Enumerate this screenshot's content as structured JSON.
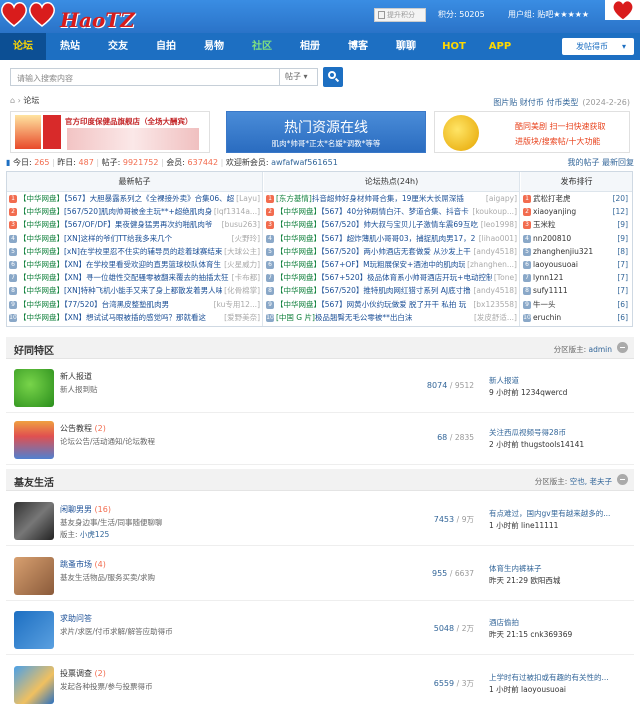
{
  "header": {
    "logo_text": "HaoTZ",
    "upgrade_label": "提升积分",
    "points": "积分: 50205",
    "user_group": "用户组: 贴吧★★★★★"
  },
  "nav": {
    "items": [
      "论坛",
      "热站",
      "交友",
      "自拍",
      "易物",
      "社区",
      "相册",
      "博客",
      "聊聊",
      "HOT",
      "APP"
    ],
    "post_select": "发帖得币"
  },
  "search": {
    "placeholder": "请输入搜索内容",
    "category": "帖子"
  },
  "breadcrumb": {
    "current": "论坛",
    "links": "图片贴 财付币 付币类型",
    "date": "(2024-2-26)"
  },
  "ads": {
    "shop": "官方印度保健品旗舰店（全场大酬宾）",
    "hot_title": "热门资源在线",
    "hot_sub": "肌肉*帅哥*正太*名媛*调教*等等",
    "right_line1": "酷同美剧 扫一扫快速获取",
    "right_line2": "进版块/搜索帖/十大功能"
  },
  "stats": {
    "today_label": "今日:",
    "today": "265",
    "yesterday_label": "昨日:",
    "yesterday": "487",
    "posts_label": "帖子:",
    "posts": "9921752",
    "members_label": "会员:",
    "members": "637442",
    "welcome_label": "欢迎新会员:",
    "newest": "awfafwaf561651",
    "my_posts": "我的帖子",
    "new_replies": "最新回复"
  },
  "hot": {
    "headers": [
      "最新帖子",
      "论坛热点(24h)",
      "发布排行"
    ],
    "latest": [
      {
        "tag": "【中华网盘】",
        "text": "【567】大胆暴露系列之《全裸接外卖》合集06、超",
        "user": "[Layu]"
      },
      {
        "tag": "【中华网盘】",
        "text": "[567/520]肌肉帅哥被金主玩**+超绝肌肉身材",
        "user": "[lqf1314a...]"
      },
      {
        "tag": "【中华网盘】",
        "text": "【567/OF/DF】果夜健身猛男再次约啪肌肉爷",
        "user": "[busu263]"
      },
      {
        "tag": "【中华网盘】",
        "text": "[XN]这样的爷们TT给我多来几个",
        "user": "[火野玲]"
      },
      {
        "tag": "【中华网盘】",
        "text": "[xN]在学校里忍不住实的辅导员的趁着球赛结束",
        "user": "[大球公主]"
      },
      {
        "tag": "【中华网盘】",
        "text": "【XN】在学校里看受欢迎的直男篮球校队体育生",
        "user": "[火星威力]"
      },
      {
        "tag": "【中华网盘】",
        "text": "【XN】寻一位雄性交配骚零被翻来覆去的抽插太狂",
        "user": "[卡布都]"
      },
      {
        "tag": "【中华网盘】",
        "text": "[XN]特种飞机小能手又来了身上都散发着男人味",
        "user": "[化骨棉掌]"
      },
      {
        "tag": "【中华网盘】",
        "text": "【77/520】台湾黑皮整塾肌肉男",
        "user": "[ku专用12...]"
      },
      {
        "tag": "【中华网盘】",
        "text": "【XN】想试试马眼被插的感觉吗？那就看这",
        "user": "[爱野美奈]"
      }
    ],
    "trending": [
      {
        "tag": "[东方基情]",
        "text": "抖音超帅好身材帅哥合集，19厘米大长屌深插",
        "user": "[aigapy]"
      },
      {
        "tag": "【中华网盘】",
        "text": "【567】40分钟刷情白汗、梦道合集、抖音卡",
        "user": "[koukoup...]"
      },
      {
        "tag": "【中华网盘】",
        "text": "【567/520】帅大叔与宝贝儿子激情车震69互吃",
        "user": "[leo1998]"
      },
      {
        "tag": "【中华网盘】",
        "text": "【567】超炸薄肌小哥哥03，捕捉肌肉男17，2",
        "user": "[lihao001]"
      },
      {
        "tag": "【中华网盘】",
        "text": "【567/520】两小帅酒店无套做爱 从沙发上干",
        "user": "[andy4518]"
      },
      {
        "tag": "【中华网盘】",
        "text": "【567+OF】M玩粗展保安+酒池中的肌肉玩",
        "user": "[zhanghen...]"
      },
      {
        "tag": "【中华网盘】",
        "text": "【567+520】极品体育系小帅哥酒店开玩+电动控制猛",
        "user": "[Tone]"
      },
      {
        "tag": "【中华网盘】",
        "text": "【567/520】推特肌肉网红猎寸系列 AJ底寸撸",
        "user": "[andy4518]"
      },
      {
        "tag": "【中华网盘】",
        "text": "【567】网黄小伙约玩做爱 脱了开干 私拍 玩",
        "user": "[bx123558]"
      },
      {
        "tag": "[中国 G 片]",
        "text": "极品翘臀无毛公零被**出白沫",
        "user": "[发皮舒适...]"
      }
    ],
    "ranking": [
      {
        "name": "武松打老虎",
        "count": "[20]"
      },
      {
        "name": "xiaoyanjing",
        "count": "[12]"
      },
      {
        "name": "玉米粒",
        "count": "[9]"
      },
      {
        "name": "nn200810",
        "count": "[9]"
      },
      {
        "name": "zhanghenjiu321",
        "count": "[8]"
      },
      {
        "name": "laoyousuoai",
        "count": "[7]"
      },
      {
        "name": "lynn121",
        "count": "[7]"
      },
      {
        "name": "sufy1111",
        "count": "[7]"
      },
      {
        "name": "牛一头",
        "count": "[6]"
      },
      {
        "name": "eruchin",
        "count": "[6]"
      }
    ]
  },
  "sections": [
    {
      "title": "好同特区",
      "mod_label": "分区版主:",
      "mods": "admin"
    },
    {
      "title": "基友生活",
      "mod_label": "分区版主:",
      "mods": "空也, 老夫子"
    }
  ],
  "forums": [
    {
      "name": "新人报道",
      "today": "",
      "desc": "新人报到贴",
      "sub": "",
      "threads": "8074",
      "posts": "9512",
      "last": "新人报道",
      "last2": "9 小时前 1234qwercd"
    },
    {
      "name": "公告教程",
      "today": "(2)",
      "desc": "论坛公告/活动通知/论坛教程",
      "sub": "",
      "threads": "68",
      "posts": "2835",
      "last": "关注西瓜视频号得28币",
      "last2": "2 小时前 thugstools14141"
    },
    {
      "name": "闲聊男男",
      "today": "(16)",
      "desc": "基友身边事/生活/同事随便聊聊",
      "sub": "小虎125",
      "sub_label": "版主:",
      "threads": "7453",
      "posts": "9万",
      "last": "有点难过，国内gv里有越来越多的...",
      "last2": "1 小时前 line11111"
    },
    {
      "name": "跳蚤市场",
      "today": "(4)",
      "desc": "基友生活物品/服务买卖/求购",
      "sub": "",
      "threads": "955",
      "posts": "6637",
      "last": "体育生内裤袜子",
      "last2": "昨天 21:29 欧阳西城"
    },
    {
      "name": "求助问答",
      "today": "",
      "desc": "求片/求医/付币求解/解答应助得币",
      "sub": "",
      "threads": "5048",
      "posts": "2万",
      "last": "酒店偷拍",
      "last2": "昨天 21:15 cnk369369"
    },
    {
      "name": "投票调查",
      "today": "(2)",
      "desc": "发起各种投票/参与投票得币",
      "sub": "",
      "threads": "6559",
      "posts": "3万",
      "last": "上学时有过被扣或有趣的有关性的...",
      "last2": "1 小时前 laoyousuoai"
    }
  ]
}
